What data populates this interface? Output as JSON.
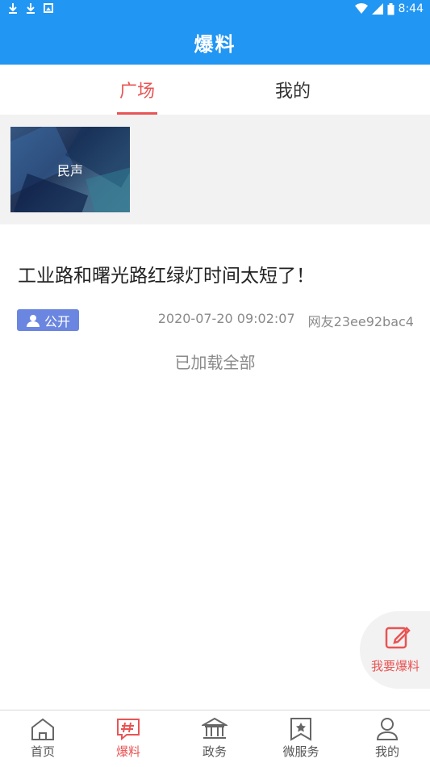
{
  "status_bar": {
    "time": "8:44"
  },
  "app_bar": {
    "title": "爆料"
  },
  "tabs": [
    {
      "label": "广场",
      "active": true
    },
    {
      "label": "我的",
      "active": false
    }
  ],
  "banner": {
    "label": "民声"
  },
  "post": {
    "title": "工业路和曙光路红绿灯时间太短了！",
    "badge": "公开",
    "datetime": "2020-07-20 09:02:07",
    "author": "网友23ee92bac4"
  },
  "list_footer": "已加载全部",
  "fab": {
    "label": "我要爆料"
  },
  "bottom_nav": [
    {
      "label": "首页",
      "icon": "home-icon",
      "active": false
    },
    {
      "label": "爆料",
      "icon": "hashtag-chat-icon",
      "active": true
    },
    {
      "label": "政务",
      "icon": "government-building-icon",
      "active": false
    },
    {
      "label": "微服务",
      "icon": "star-bookmark-icon",
      "active": false
    },
    {
      "label": "我的",
      "icon": "user-icon",
      "active": false
    }
  ],
  "colors": {
    "primary": "#2196f3",
    "accent": "#e95454",
    "badge": "#6b86e0"
  }
}
